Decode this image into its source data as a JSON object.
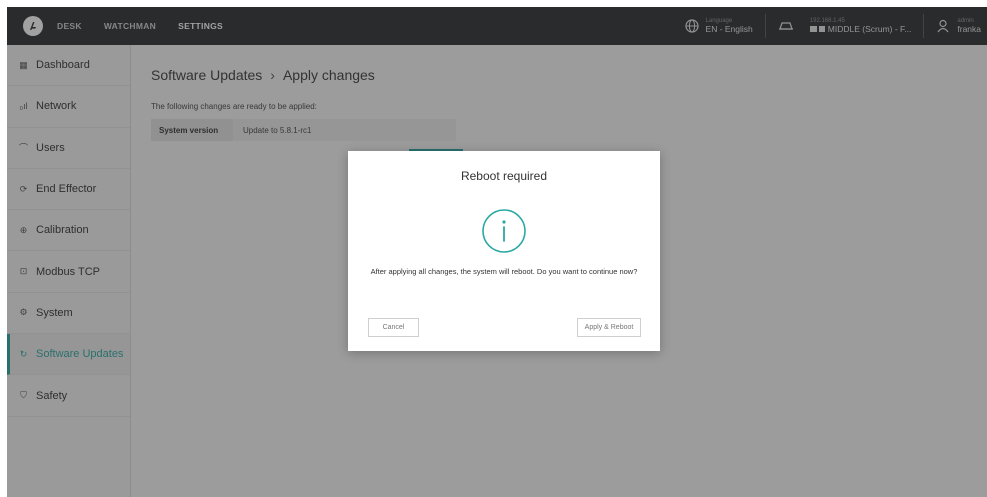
{
  "topbar": {
    "nav": [
      "DESK",
      "WATCHMAN",
      "SETTINGS"
    ],
    "active_nav": "SETTINGS",
    "language_label": "Language",
    "language_value": "EN - English",
    "robot_ip": "192.168.1.45",
    "robot_name": "MIDDLE (Scrum) - F...",
    "user_role": "admin",
    "user_name": "franka"
  },
  "sidebar": {
    "items": [
      {
        "label": "Dashboard",
        "icon": "dashboard-icon",
        "glyph": "▦"
      },
      {
        "label": "Network",
        "icon": "network-icon",
        "glyph": "₀ıl"
      },
      {
        "label": "Users",
        "icon": "users-icon",
        "glyph": "⌒"
      },
      {
        "label": "End Effector",
        "icon": "end-effector-icon",
        "glyph": "⟳"
      },
      {
        "label": "Calibration",
        "icon": "calibration-icon",
        "glyph": "⊕"
      },
      {
        "label": "Modbus TCP",
        "icon": "modbus-icon",
        "glyph": "⊡"
      },
      {
        "label": "System",
        "icon": "system-icon",
        "glyph": "⚙"
      },
      {
        "label": "Software Updates",
        "icon": "software-updates-icon",
        "glyph": "↻"
      },
      {
        "label": "Safety",
        "icon": "safety-icon",
        "glyph": "⛉"
      }
    ],
    "active_index": 7
  },
  "main": {
    "breadcrumb": [
      "Software Updates",
      "Apply changes"
    ],
    "intro": "The following changes are ready to be applied:",
    "changes": [
      {
        "key": "System version",
        "value": "Update to 5.8.1-rc1"
      }
    ]
  },
  "modal": {
    "title": "Reboot required",
    "message": "After applying all changes, the system will reboot. Do you want to continue now?",
    "cancel_label": "Cancel",
    "apply_label": "Apply & Reboot"
  },
  "colors": {
    "accent": "#2aa8a3",
    "topbar": "#2b2d30",
    "overlay": "rgba(40,40,40,0.44)"
  }
}
